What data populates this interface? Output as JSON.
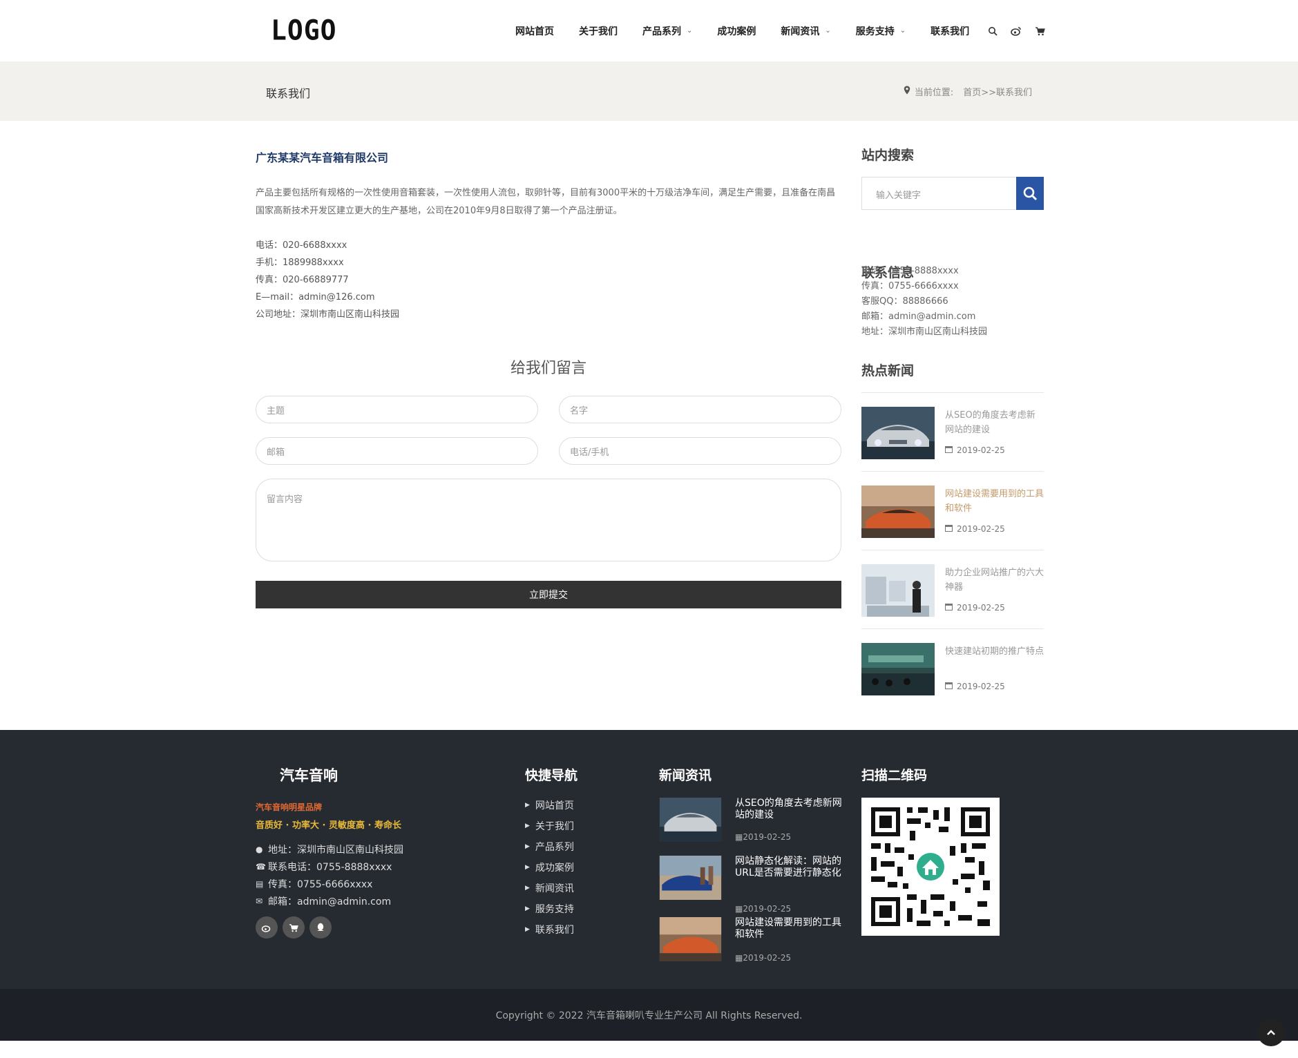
{
  "header": {
    "logo": "LOGO",
    "nav": [
      {
        "label": "网站首页",
        "dropdown": false
      },
      {
        "label": "关于我们",
        "dropdown": false
      },
      {
        "label": "产品系列",
        "dropdown": true
      },
      {
        "label": "成功案例",
        "dropdown": false
      },
      {
        "label": "新闻资讯",
        "dropdown": true
      },
      {
        "label": "服务支持",
        "dropdown": true
      },
      {
        "label": "联系我们",
        "dropdown": false
      }
    ],
    "icons": [
      "search-icon",
      "weibo-icon",
      "cart-icon"
    ]
  },
  "banner": {
    "title": "联系我们",
    "crumb_label": "当前位置:",
    "crumb_path": "首页>>联系我们"
  },
  "main": {
    "company": "广东某某汽车音箱有限公司",
    "intro": "产品主要包括所有规格的一次性使用音箱套装，一次性使用人流包，取卵针等，目前有3000平米的十万级洁净车间，满足生产需要，且准备在南昌国家高新技术开发区建立更大的生产基地，公司在2010年9月8日取得了第一个产品注册证。",
    "contacts": [
      "电话：020-6688xxxx",
      "手机：1889988xxxx",
      "传真：020-66889777",
      "E—mail：admin@126.com",
      "公司地址：深圳市南山区南山科技园"
    ],
    "form": {
      "title": "给我们留言",
      "subject_ph": "主题",
      "name_ph": "名字",
      "email_ph": "邮箱",
      "phone_ph": "电话/手机",
      "content_ph": "留言内容",
      "submit": "立即提交"
    }
  },
  "sidebar": {
    "search_title": "站内搜索",
    "search_ph": "输入关键字",
    "contact_title": "联系信息",
    "contacts": [
      "电话：0755-8888xxxx",
      "传真：0755-6666xxxx",
      "客服QQ：88886666",
      "邮箱：admin@admin.com",
      "地址：深圳市南山区南山科技园"
    ],
    "hot_title": "热点新闻",
    "news": [
      {
        "title": "从SEO的角度去考虑新网站的建设",
        "date": "2019-02-25"
      },
      {
        "title": "网站建设需要用到的工具和软件",
        "date": "2019-02-25"
      },
      {
        "title": "助力企业网站推广的六大神器",
        "date": "2019-02-25"
      },
      {
        "title": "快速建站初期的推广特点",
        "date": "2019-02-25"
      }
    ]
  },
  "footer": {
    "brand": "汽车音响",
    "tag1": "汽车音响明星品牌",
    "tag2": "音质好 · 功率大 · 灵敏度高 · 寿命长",
    "address": "地址：深圳市南山区南山科技园",
    "phone": "联系电话：0755-8888xxxx",
    "fax": "传真：0755-6666xxxx",
    "email": "邮箱：admin@admin.com",
    "quick_title": "快捷导航",
    "quick_links": [
      "网站首页",
      "关于我们",
      "产品系列",
      "成功案例",
      "新闻资讯",
      "服务支持",
      "联系我们"
    ],
    "news_title": "新闻资讯",
    "news": [
      {
        "title": "从SEO的角度去考虑新网站的建设",
        "date": "2019-02-25"
      },
      {
        "title": "网站静态化解读：网站的URL是否需要进行静态化",
        "date": "2019-02-25"
      },
      {
        "title": "网站建设需要用到的工具和软件",
        "date": "2019-02-25"
      }
    ],
    "qr_title": "扫描二维码",
    "copyright": "Copyright © 2022 汽车音箱喇叭专业生产公司 All Rights Reserved."
  },
  "colors": {
    "accent_blue": "#2a55a5",
    "footer_bg": "#262a31",
    "company_title": "#1f3a68",
    "tag_orange": "#e26a32",
    "tag_yellow": "#e8b83a"
  }
}
